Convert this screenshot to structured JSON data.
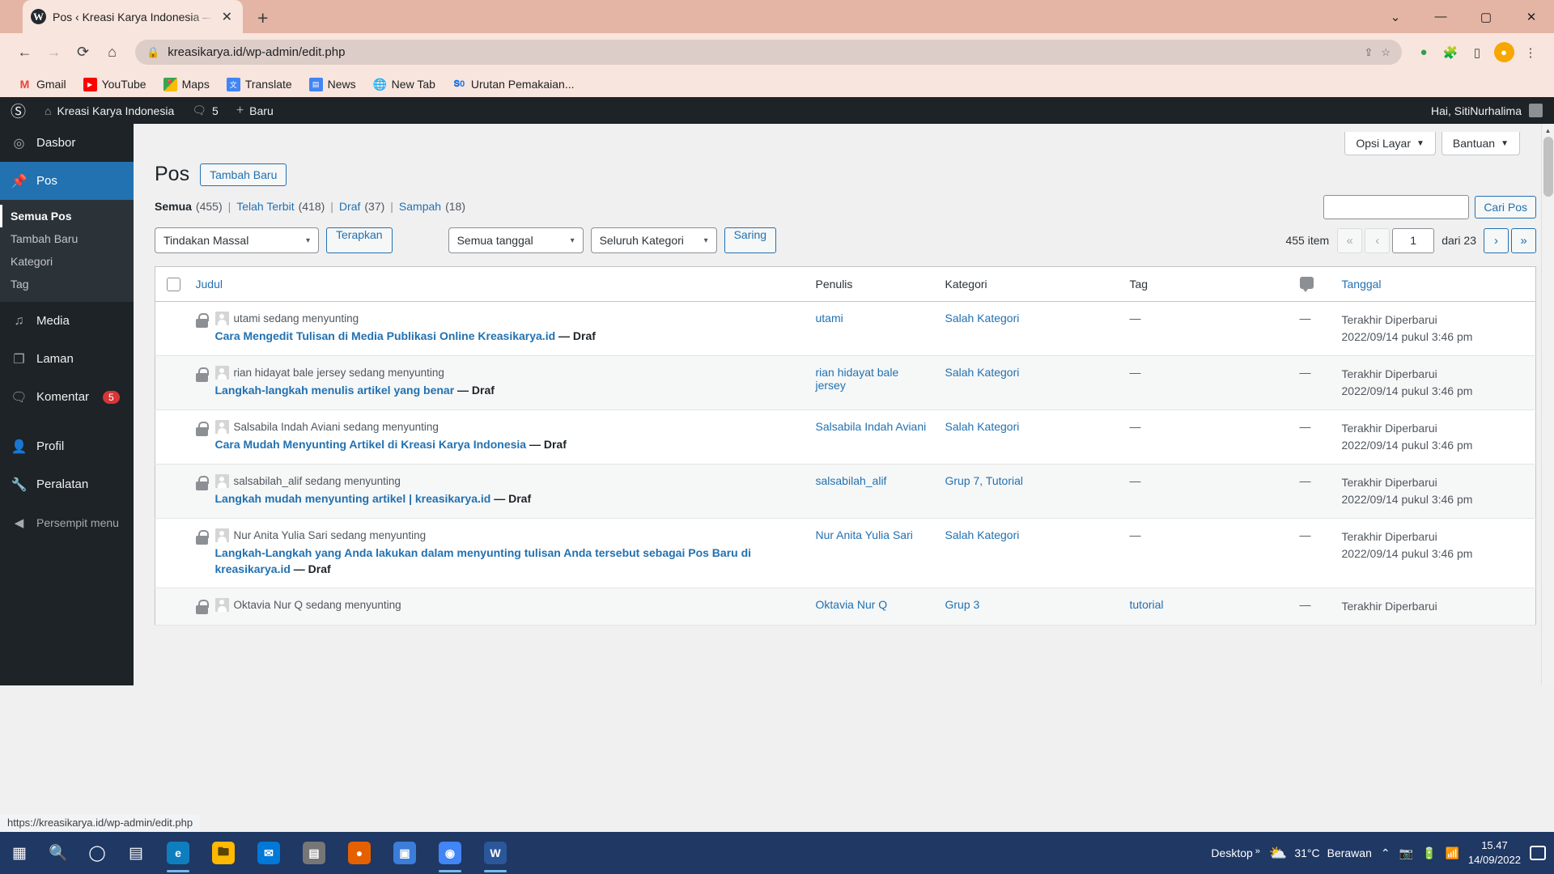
{
  "browser": {
    "tab_title": "Pos ‹ Kreasi Karya Indonesia — W",
    "tab_favicon": "wordpress-icon",
    "new_tab_label": "+",
    "url": "kreasikarya.id/wp-admin/edit.php",
    "nav": {
      "back": "←",
      "forward": "→",
      "reload": "⟳",
      "home": "⌂",
      "lock": "🔒",
      "share": "⇪",
      "star": "☆",
      "menu": "⋮"
    },
    "window": {
      "minimize": "—",
      "maximize": "▢",
      "close": "✕",
      "more": "⌄"
    },
    "bookmarks": [
      {
        "label": "Gmail",
        "icon": "gmail-icon",
        "glyph": "M",
        "color": "#ea4335",
        "bg": "#ffffff"
      },
      {
        "label": "YouTube",
        "icon": "youtube-icon",
        "glyph": "▶",
        "color": "#ffffff",
        "bg": "#ff0000"
      },
      {
        "label": "Maps",
        "icon": "maps-icon",
        "glyph": "◆",
        "color": "#34a853",
        "bg": "#ffffff"
      },
      {
        "label": "Translate",
        "icon": "translate-icon",
        "glyph": "文",
        "color": "#ffffff",
        "bg": "#4285f4"
      },
      {
        "label": "News",
        "icon": "news-icon",
        "glyph": "▤",
        "color": "#ffffff",
        "bg": "#4285f4"
      },
      {
        "label": "New Tab",
        "icon": "globe-icon",
        "glyph": "🌐",
        "color": "#1d2327",
        "bg": "#ffffff"
      },
      {
        "label": "Urutan Pemakaian...",
        "icon": "docs-icon",
        "glyph": "ǁ0",
        "color": "#1a73e8",
        "bg": "#ffffff"
      }
    ],
    "status_bar_url": "https://kreasikarya.id/wp-admin/edit.php"
  },
  "adminbar": {
    "wp_logo": "wordpress-logo",
    "site_name": "Kreasi Karya Indonesia",
    "site_icon": "home-icon",
    "comments_icon": "comment-bubble-icon",
    "comments_count": "5",
    "new_icon": "plus-icon",
    "new_label": "Baru",
    "howdy": "Hai, SitiNurhalima"
  },
  "sidebar": {
    "items": [
      {
        "label": "Dasbor",
        "icon": "dashboard-icon",
        "glyph": "◉",
        "current": false
      },
      {
        "label": "Pos",
        "icon": "pin-icon",
        "glyph": "📌",
        "current": true
      },
      {
        "label": "Media",
        "icon": "media-icon",
        "glyph": "♫",
        "current": false
      },
      {
        "label": "Laman",
        "icon": "pages-icon",
        "glyph": "❐",
        "current": false
      },
      {
        "label": "Komentar",
        "icon": "comment-icon",
        "glyph": "💬",
        "current": false,
        "badge": "5"
      },
      {
        "label": "Profil",
        "icon": "user-icon",
        "glyph": "👤",
        "current": false
      },
      {
        "label": "Peralatan",
        "icon": "tools-icon",
        "glyph": "🔧",
        "current": false
      },
      {
        "label": "Persempit menu",
        "icon": "collapse-icon",
        "glyph": "◀",
        "current": false
      }
    ],
    "submenu": [
      {
        "label": "Semua Pos",
        "current": true
      },
      {
        "label": "Tambah Baru",
        "current": false
      },
      {
        "label": "Kategori",
        "current": false
      },
      {
        "label": "Tag",
        "current": false
      }
    ]
  },
  "screen_meta": {
    "screen_options": "Opsi Layar",
    "help": "Bantuan",
    "caret": "▼"
  },
  "page": {
    "title": "Pos",
    "add_new": "Tambah Baru"
  },
  "status_links": [
    {
      "label": "Semua",
      "count": "(455)",
      "current": true
    },
    {
      "label": "Telah Terbit",
      "count": "(418)",
      "current": false
    },
    {
      "label": "Draf",
      "count": "(37)",
      "current": false
    },
    {
      "label": "Sampah",
      "count": "(18)",
      "current": false
    }
  ],
  "search": {
    "value": "",
    "placeholder": "",
    "button": "Cari Pos"
  },
  "tablenav": {
    "bulk_action": "Tindakan Massal",
    "apply": "Terapkan",
    "date_filter": "Semua tanggal",
    "category_filter": "Seluruh Kategori",
    "filter": "Saring",
    "chevron": "⌄"
  },
  "pagination": {
    "total_items": "455 item",
    "first": "«",
    "prev": "‹",
    "current_page": "1",
    "of_label": "dari 23",
    "next": "›",
    "last": "»"
  },
  "table": {
    "headers": {
      "title": "Judul",
      "author": "Penulis",
      "category": "Kategori",
      "tag": "Tag",
      "comments_icon": "comment-bubble-icon",
      "date": "Tanggal"
    },
    "rows": [
      {
        "locked_by": "utami sedang menyunting",
        "title": "Cara Mengedit Tulisan di Media Publikasi Online Kreasikarya.id",
        "state": "— Draf",
        "author": "utami",
        "category": "Salah Kategori",
        "tag": "—",
        "comments": "—",
        "date_label": "Terakhir Diperbarui",
        "date_value": "2022/09/14 pukul 3:46 pm"
      },
      {
        "locked_by": "rian hidayat bale jersey sedang menyunting",
        "title": "Langkah-langkah menulis artikel yang benar",
        "state": "— Draf",
        "author": "rian hidayat bale jersey",
        "category": "Salah Kategori",
        "tag": "—",
        "comments": "—",
        "date_label": "Terakhir Diperbarui",
        "date_value": "2022/09/14 pukul 3:46 pm"
      },
      {
        "locked_by": "Salsabila Indah Aviani sedang menyunting",
        "title": "Cara Mudah Menyunting Artikel di Kreasi Karya Indonesia",
        "state": "— Draf",
        "author": "Salsabila Indah Aviani",
        "category": "Salah Kategori",
        "tag": "—",
        "comments": "—",
        "date_label": "Terakhir Diperbarui",
        "date_value": "2022/09/14 pukul 3:46 pm"
      },
      {
        "locked_by": "salsabilah_alif sedang menyunting",
        "title": "Langkah mudah menyunting artikel | kreasikarya.id",
        "state": "— Draf",
        "author": "salsabilah_alif",
        "category": "Grup 7, Tutorial",
        "tag": "—",
        "comments": "—",
        "date_label": "Terakhir Diperbarui",
        "date_value": "2022/09/14 pukul 3:46 pm"
      },
      {
        "locked_by": "Nur Anita Yulia Sari sedang menyunting",
        "title": "Langkah-Langkah yang Anda lakukan dalam menyunting tulisan Anda tersebut sebagai Pos Baru di kreasikarya.id",
        "state": "— Draf",
        "author": "Nur Anita Yulia Sari",
        "category": "Salah Kategori",
        "tag": "—",
        "comments": "—",
        "date_label": "Terakhir Diperbarui",
        "date_value": "2022/09/14 pukul 3:46 pm"
      },
      {
        "locked_by": "Oktavia Nur Q sedang menyunting",
        "title": "",
        "state": "",
        "author": "Oktavia Nur Q",
        "category": "Grup 3",
        "tag": "tutorial",
        "comments": "—",
        "date_label": "Terakhir Diperbarui",
        "date_value": ""
      }
    ]
  },
  "taskbar": {
    "start_icon": "windows-start-icon",
    "search_icon": "search-icon",
    "cortana_icon": "cortana-circle-icon",
    "taskview_icon": "task-view-icon",
    "apps": [
      {
        "name": "edge-icon",
        "glyph": "e",
        "color": "#0f7ebf",
        "running": true
      },
      {
        "name": "file-explorer-icon",
        "glyph": "🗀",
        "color": "#ffb900",
        "running": false
      },
      {
        "name": "mail-icon",
        "glyph": "✉",
        "color": "#0078d7",
        "running": false
      },
      {
        "name": "store-icon",
        "glyph": "▤",
        "color": "#767676",
        "running": false
      },
      {
        "name": "firefox-icon",
        "glyph": "🦊",
        "color": "#e66000",
        "running": false
      },
      {
        "name": "photos-icon",
        "glyph": "▣",
        "color": "#3b7dd8",
        "running": false
      },
      {
        "name": "chrome-icon",
        "glyph": "◉",
        "color": "#4285f4",
        "running": true
      },
      {
        "name": "word-icon",
        "glyph": "W",
        "color": "#2b579a",
        "running": true
      }
    ],
    "desktop_label": "Desktop",
    "desktop_chevron": "»",
    "weather_icon": "partly-cloudy-icon",
    "weather_temp": "31°C",
    "weather_desc": "Berawan",
    "tray_up": "⌃",
    "tray_camera": "camera-icon",
    "tray_battery": "battery-icon",
    "tray_wifi": "wifi-icon",
    "time": "15.47",
    "date": "14/09/2022",
    "notification_icon": "notification-icon"
  }
}
